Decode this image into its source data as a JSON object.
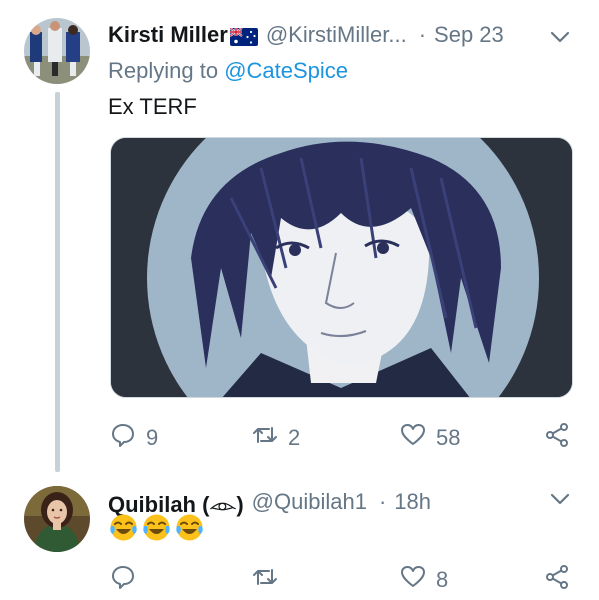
{
  "tweets": [
    {
      "author_name": "Kirsti Miller",
      "author_flag": "flag-australia-icon",
      "author_handle": "@KirstiMiller...",
      "separator": "·",
      "time": "Sep 23",
      "replying_prefix": "Replying to",
      "replying_to": "@CateSpice",
      "text": "Ex TERF",
      "media": "drawn-portrait-image",
      "actions": {
        "reply_count": "9",
        "retweet_count": "2",
        "like_count": "58"
      }
    },
    {
      "author_name": "Quibilah (𓁹)",
      "author_handle": "@Quibilah1",
      "separator": "·",
      "time": "18h",
      "emojis": [
        "face-with-tears-of-joy",
        "face-with-tears-of-joy",
        "face-with-tears-of-joy"
      ],
      "actions": {
        "reply_count": "",
        "retweet_count": "",
        "like_count": "8"
      }
    }
  ],
  "colors": {
    "text": "#14171a",
    "secondary": "#657786",
    "link": "#1b95e0",
    "thread_line": "#c7d1d8"
  }
}
